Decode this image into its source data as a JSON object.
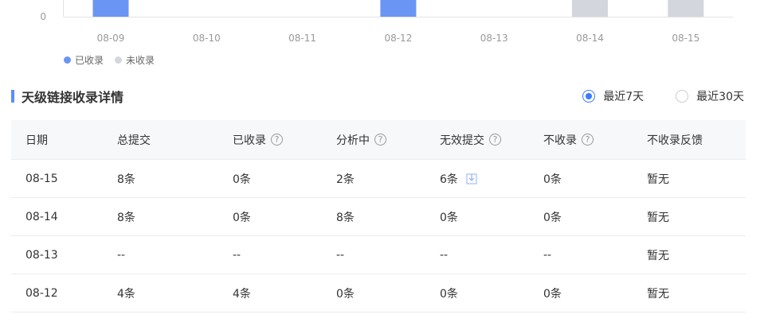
{
  "chart_data": {
    "type": "bar",
    "categories": [
      "08-09",
      "08-10",
      "08-11",
      "08-12",
      "08-13",
      "08-14",
      "08-15"
    ],
    "series": [
      {
        "name": "已收录",
        "color": "#6b95f5",
        "visible_categories": [
          "08-09",
          "08-12"
        ]
      },
      {
        "name": "未收录",
        "color": "#d3d6dd",
        "visible_categories": [
          "08-14",
          "08-15"
        ]
      }
    ],
    "y_tick_labels": [
      "0"
    ],
    "legend_position": "bottom-left"
  },
  "legend": [
    {
      "label": "已收录",
      "color": "#6b95f5"
    },
    {
      "label": "未收录",
      "color": "#d3d6dd"
    }
  ],
  "section": {
    "title": "天级链接收录详情",
    "accent": "#5b8ff9"
  },
  "range": {
    "options": [
      {
        "label": "最近7天",
        "checked": true
      },
      {
        "label": "最近30天",
        "checked": false
      }
    ]
  },
  "table": {
    "headers": [
      "日期",
      "总提交",
      "已收录",
      "分析中",
      "无效提交",
      "不收录",
      "不收录反馈"
    ],
    "help_mark": "?",
    "rows": [
      [
        "08-15",
        "8条",
        "0条",
        "2条",
        "6条",
        "0条",
        "暂无"
      ],
      [
        "08-14",
        "8条",
        "0条",
        "8条",
        "0条",
        "0条",
        "暂无"
      ],
      [
        "08-13",
        "--",
        "--",
        "--",
        "--",
        "--",
        "暂无"
      ],
      [
        "08-12",
        "4条",
        "4条",
        "0条",
        "0条",
        "0条",
        "暂无"
      ]
    ]
  }
}
